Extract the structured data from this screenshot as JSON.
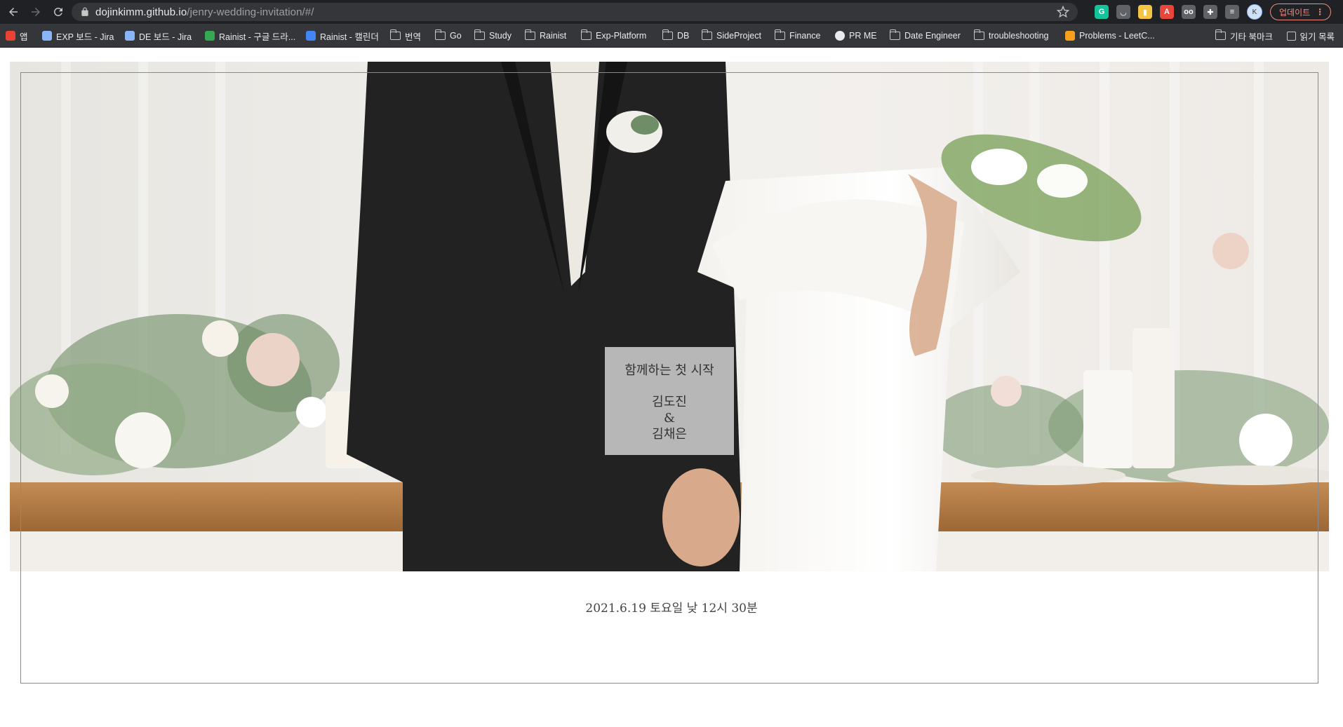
{
  "browser": {
    "url_host": "dojinkimm.github.io",
    "url_path": "/jenry-wedding-invitation/#/",
    "update_label": "업데이트",
    "update_menu": "⋮",
    "avatar_initial": "K",
    "extensions": [
      {
        "name": "grammarly-icon",
        "glyph": "G",
        "color": "#15c39a"
      },
      {
        "name": "pocket-icon",
        "glyph": "◡",
        "color": "#5f6368"
      },
      {
        "name": "bag-icon",
        "glyph": "▮",
        "color": "#f4c542"
      },
      {
        "name": "translate-ext-icon",
        "glyph": "A",
        "color": "#e8453c"
      },
      {
        "name": "glasses-icon",
        "glyph": "oo",
        "color": "#5f6368"
      },
      {
        "name": "puzzle-icon",
        "glyph": "✚",
        "color": "#5f6368"
      },
      {
        "name": "reading-list-icon",
        "glyph": "≡",
        "color": "#5f6368"
      }
    ]
  },
  "bookmarks": {
    "items": [
      {
        "label": "앱",
        "icon": "apps-icon"
      },
      {
        "label": "EXP 보드 - Jira",
        "icon": "jira-icon"
      },
      {
        "label": "DE 보드 - Jira",
        "icon": "jira-icon"
      },
      {
        "label": "Rainist - 구글 드라...",
        "icon": "drive-icon"
      },
      {
        "label": "Rainist - 캘린더",
        "icon": "calendar-icon"
      },
      {
        "label": "번역",
        "icon": "folder-icon"
      },
      {
        "label": "Go",
        "icon": "folder-icon"
      },
      {
        "label": "Study",
        "icon": "folder-icon"
      },
      {
        "label": "Rainist",
        "icon": "folder-icon"
      },
      {
        "label": "Exp-Platform",
        "icon": "folder-icon"
      },
      {
        "label": "DB",
        "icon": "folder-icon"
      },
      {
        "label": "SideProject",
        "icon": "folder-icon"
      },
      {
        "label": "Finance",
        "icon": "folder-icon"
      },
      {
        "label": "PR ME",
        "icon": "github-icon"
      },
      {
        "label": "Date Engineer",
        "icon": "folder-icon"
      },
      {
        "label": "troubleshooting",
        "icon": "folder-icon"
      },
      {
        "label": "Problems - LeetC...",
        "icon": "leetcode-icon"
      }
    ],
    "other_bookmarks": "기타 북마크",
    "reading_list": "읽기 목록"
  },
  "invitation": {
    "tagline": "함께하는 첫 시작",
    "groom": "김도진",
    "ampersand": "&",
    "bride": "김채은",
    "date_text": "2021.6.19 토요일 낮 12시 30분"
  }
}
